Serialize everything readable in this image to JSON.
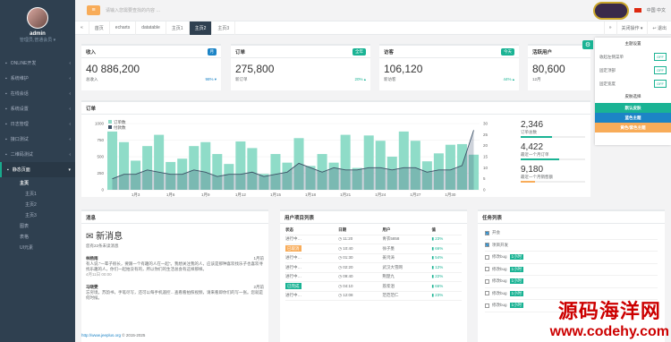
{
  "user": {
    "name": "admin",
    "role": "管理员,普通会员 ▾"
  },
  "search": {
    "placeholder": "请输入您需要查找的内容 …"
  },
  "top": {
    "lang": "中国 中文"
  },
  "nav": [
    {
      "label": "ONLINE开发"
    },
    {
      "label": "系统维护"
    },
    {
      "label": "在线会话"
    },
    {
      "label": "系统设置"
    },
    {
      "label": "日志管理"
    },
    {
      "label": "接口测试"
    },
    {
      "label": "二维码测试"
    },
    {
      "label": "静态页面"
    }
  ],
  "subnav": {
    "home": "主页",
    "home1": "主页1",
    "home2": "主页2",
    "home3": "主页3",
    "chart": "图表",
    "form": "表格",
    "ui": "UI元素"
  },
  "tabs": [
    "首页",
    "echarts",
    "datatable",
    "主页1",
    "主页2",
    "主页3"
  ],
  "tab_actions": {
    "close": "关闭操作 ▾",
    "back": "↩ 退出"
  },
  "stats": [
    {
      "title": "收入",
      "badge": "月",
      "value": "40 886,200",
      "sub": "总收入",
      "pct": "98% ▾",
      "color": "#1c84c6"
    },
    {
      "title": "订单",
      "badge": "全年",
      "value": "275,800",
      "sub": "新订单",
      "pct": "20% ▴",
      "color": "#1ab394"
    },
    {
      "title": "访客",
      "badge": "今天",
      "value": "106,120",
      "sub": "新访客",
      "pct": "44% ▴",
      "color": "#1ab394"
    },
    {
      "title": "活跃用户",
      "badge": "",
      "value": "80,600",
      "sub": "12月",
      "pct": "",
      "color": "#ed5565"
    }
  ],
  "settings": {
    "title": "主题设置",
    "rows": [
      {
        "label": "收起左侧菜单",
        "state": "OFF"
      },
      {
        "label": "固定顶部",
        "state": "OFF"
      },
      {
        "label": "固定宽度",
        "state": "OFF"
      }
    ],
    "skin_title": "皮肤选择",
    "skins": [
      {
        "label": "默认皮肤",
        "color": "#1ab394"
      },
      {
        "label": "蓝色主题",
        "color": "#1c84c6"
      },
      {
        "label": "黄色/紫色主题",
        "color": "#f8ac59"
      }
    ]
  },
  "orders": {
    "title": "订单",
    "side": [
      {
        "value": "2,346",
        "label": "订单总数",
        "color": "#1ab394",
        "fill": 0.48
      },
      {
        "value": "4,422",
        "label": "最近一个月订单",
        "color": "#1ab394",
        "fill": 0.6
      },
      {
        "value": "9,180",
        "label": "最近一个月销售额",
        "color": "#f8ac59",
        "fill": 0.22
      }
    ]
  },
  "chart_data": {
    "type": "bar",
    "legend": [
      "订单数",
      "付款数"
    ],
    "categories": [
      "1月3",
      "1月6",
      "1月9",
      "1月12",
      "1月15",
      "1月18",
      "1月21",
      "1月24",
      "1月27",
      "1月30"
    ],
    "ylim": [
      0,
      1000
    ],
    "y2lim": [
      0,
      30
    ],
    "yticks": [
      0,
      250,
      500,
      750,
      1000
    ],
    "y2ticks": [
      0,
      5,
      10,
      15,
      20,
      25,
      30
    ],
    "bars": [
      880,
      720,
      440,
      660,
      830,
      420,
      470,
      660,
      720,
      540,
      390,
      730,
      630,
      240,
      540,
      410,
      780,
      360,
      540,
      410,
      830,
      330,
      820,
      740,
      500,
      880,
      740,
      430,
      550,
      680,
      690,
      530
    ],
    "line": [
      5,
      7,
      7,
      9,
      8,
      7,
      7,
      9,
      8,
      6,
      7,
      7,
      8,
      6,
      7,
      8,
      12,
      10,
      8,
      10,
      9,
      9,
      10,
      10,
      9,
      10,
      10,
      8,
      9,
      9,
      11,
      27
    ]
  },
  "messages": {
    "title": "消息",
    "head": "新消息",
    "count": "您有22条未读消息",
    "items": [
      {
        "name": "林杨雨",
        "time": "1月前",
        "text": "有人说:\"一辈子很长，要跟一个有趣的人在一起\"。我想关注我的人，应该是那种喜欢找乐子也喜欢寻找乐趣的人，你们一起拍没有的，所以你们的生活总会有这样那样。",
        "date": "4月11日 00:00"
      },
      {
        "name": "马晓雯",
        "time": "2月前",
        "text": "忘穷境，苏韵书，手笔尽写，还可以每手机遥控…查看看拍照视频，请来看即你们的写一张。您就是何时候。",
        "date": ""
      }
    ]
  },
  "projects": {
    "title": "用户项目列表",
    "cols": [
      "状态",
      "日期",
      "用户",
      "值"
    ],
    "rows": [
      {
        "status": "进行中…",
        "label": "",
        "date": "11:20",
        "user": "青衣5858",
        "val": "▮ 23%"
      },
      {
        "status": "",
        "label": "已取消",
        "date": "10:40",
        "user": "徐子墨",
        "val": "▮ 66%"
      },
      {
        "status": "进行中…",
        "label": "",
        "date": "01:30",
        "user": "姜鸿涛",
        "val": "▮ 54%"
      },
      {
        "status": "进行中…",
        "label": "",
        "date": "02:20",
        "user": "武汉大雪网",
        "val": "▮ 12%"
      },
      {
        "status": "进行中…",
        "label": "",
        "date": "09:40",
        "user": "荆楚九",
        "val": "▮ 22%"
      },
      {
        "status": "",
        "label": "已完成",
        "date": "04:10",
        "user": "荔浆泪",
        "val": "▮ 66%"
      },
      {
        "status": "进行中…",
        "label": "",
        "date": "12:08",
        "user": "范范范仁",
        "val": "▮ 23%"
      }
    ]
  },
  "tasks": {
    "title": "任务列表",
    "items": [
      {
        "label": "开会",
        "tag": "",
        "checked": true
      },
      {
        "label": "项目开发",
        "tag": "",
        "checked": true
      },
      {
        "label": "修改bug",
        "tag": "1小时",
        "checked": false
      },
      {
        "label": "修改bug",
        "tag": "1小时",
        "checked": false
      },
      {
        "label": "修改bug",
        "tag": "1小时",
        "checked": false
      },
      {
        "label": "修改bug",
        "tag": "1小时",
        "checked": false
      },
      {
        "label": "修改bug",
        "tag": "1小时",
        "checked": false
      }
    ]
  },
  "footer": {
    "link": "http://www.jeeplus.org",
    "copy": "© 2015-2025"
  },
  "watermark": {
    "line1": "源码海洋网",
    "line2": "www.codehy.com"
  }
}
